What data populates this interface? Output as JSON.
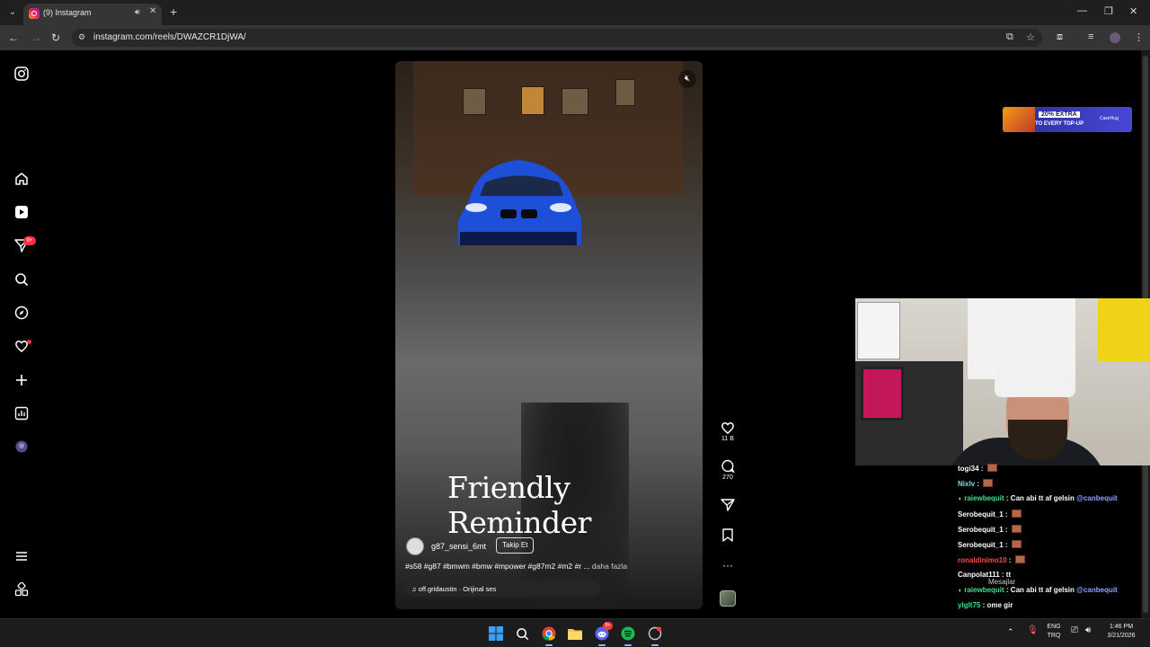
{
  "browser": {
    "tab_title": "(9) Instagram",
    "url": "instagram.com/reels/DWAZCR1DjWA/"
  },
  "sidebar": {
    "notifications_badge": "9+"
  },
  "reel": {
    "caption_overlay": "Friendly Reminder",
    "author": "g87_sensi_6mt",
    "follow_label": "Takip Et",
    "hashtags": "#s58 #g87 #bmwm #bmw #mpower #g87m2 #m2 #r ...",
    "more_label": "daha fazla",
    "audio": "off.gridaustin · Orijinal ses",
    "likes": "11 B",
    "comments": "270"
  },
  "ad": {
    "line1": "20% EXTRA",
    "line2": "TO EVERY TOP-UP",
    "brand": "CaseHug"
  },
  "chat": {
    "messages": [
      {
        "user": "togi34",
        "color": "#ffffff",
        "text": "",
        "emote": true,
        "badge": false
      },
      {
        "user": "Nixlv",
        "color": "#7fe0d8",
        "text": "",
        "emote": true,
        "badge": false
      },
      {
        "user": "raiewbequit",
        "color": "#3fe08c",
        "text": "Can abi tt af gelsin ",
        "mention": "@canbequit",
        "emote": false,
        "badge": true
      },
      {
        "user": "Serobequit_1",
        "color": "#ffffff",
        "text": "",
        "emote": true,
        "badge": false
      },
      {
        "user": "Serobequit_1",
        "color": "#ffffff",
        "text": "",
        "emote": true,
        "badge": false
      },
      {
        "user": "Serobequit_1",
        "color": "#ffffff",
        "text": "",
        "emote": true,
        "badge": false
      },
      {
        "user": "ronaldinimo10",
        "color": "#ff4a4a",
        "text": "",
        "emote": true,
        "badge": false
      },
      {
        "user": "Canpolat111",
        "color": "#ffffff",
        "text": "tt",
        "emote": false,
        "badge": false
      },
      {
        "user": "raiewbequit",
        "color": "#3fe08c",
        "text": "Can abi tt af gelsin ",
        "mention": "@canbequit",
        "emote": false,
        "badge": true
      },
      {
        "user": "ylglt75",
        "color": "#3fe08c",
        "text": "ome gir",
        "emote": false,
        "badge": false
      }
    ],
    "overlay_label": "Mesajlar"
  },
  "taskbar": {
    "lang_top": "ENG",
    "lang_bottom": "TRQ",
    "time": "1:46 PM",
    "date": "3/21/2026",
    "discord_badge": "9+"
  }
}
